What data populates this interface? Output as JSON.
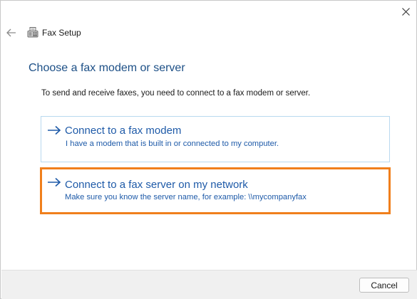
{
  "window": {
    "title": "Fax Setup",
    "close_icon": "close-icon",
    "back_icon": "back-arrow-icon",
    "app_icon": "fax-machine-icon"
  },
  "main": {
    "heading": "Choose a fax modem or server",
    "intro": "To send and receive faxes, you need to connect to a fax modem or server.",
    "options": [
      {
        "title": "Connect to a fax modem",
        "description": "I have a modem that is built in or connected to my computer.",
        "icon": "arrow-right-icon",
        "highlighted": false
      },
      {
        "title": "Connect to a fax server on my network",
        "description": "Make sure you know the server name, for example: \\\\mycompanyfax",
        "icon": "arrow-right-icon",
        "highlighted": true
      }
    ]
  },
  "footer": {
    "cancel_label": "Cancel"
  },
  "colors": {
    "heading": "#1c4f86",
    "link": "#1e5aa8",
    "highlight_border": "#f07f1c",
    "option_border": "#b9d9ef",
    "footer_bg": "#f0f0f0"
  }
}
